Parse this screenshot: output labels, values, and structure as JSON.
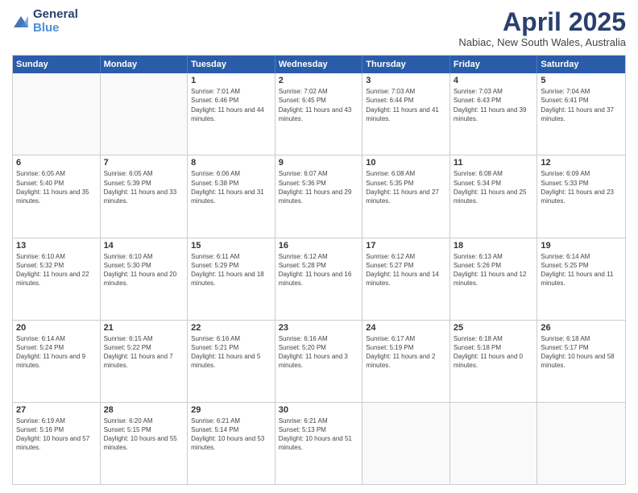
{
  "header": {
    "logo_line1": "General",
    "logo_line2": "Blue",
    "month": "April 2025",
    "location": "Nabiac, New South Wales, Australia"
  },
  "days_of_week": [
    "Sunday",
    "Monday",
    "Tuesday",
    "Wednesday",
    "Thursday",
    "Friday",
    "Saturday"
  ],
  "weeks": [
    [
      {
        "day": "",
        "sunrise": "",
        "sunset": "",
        "daylight": ""
      },
      {
        "day": "",
        "sunrise": "",
        "sunset": "",
        "daylight": ""
      },
      {
        "day": "1",
        "sunrise": "Sunrise: 7:01 AM",
        "sunset": "Sunset: 6:46 PM",
        "daylight": "Daylight: 11 hours and 44 minutes."
      },
      {
        "day": "2",
        "sunrise": "Sunrise: 7:02 AM",
        "sunset": "Sunset: 6:45 PM",
        "daylight": "Daylight: 11 hours and 43 minutes."
      },
      {
        "day": "3",
        "sunrise": "Sunrise: 7:03 AM",
        "sunset": "Sunset: 6:44 PM",
        "daylight": "Daylight: 11 hours and 41 minutes."
      },
      {
        "day": "4",
        "sunrise": "Sunrise: 7:03 AM",
        "sunset": "Sunset: 6:43 PM",
        "daylight": "Daylight: 11 hours and 39 minutes."
      },
      {
        "day": "5",
        "sunrise": "Sunrise: 7:04 AM",
        "sunset": "Sunset: 6:41 PM",
        "daylight": "Daylight: 11 hours and 37 minutes."
      }
    ],
    [
      {
        "day": "6",
        "sunrise": "Sunrise: 6:05 AM",
        "sunset": "Sunset: 5:40 PM",
        "daylight": "Daylight: 11 hours and 35 minutes."
      },
      {
        "day": "7",
        "sunrise": "Sunrise: 6:05 AM",
        "sunset": "Sunset: 5:39 PM",
        "daylight": "Daylight: 11 hours and 33 minutes."
      },
      {
        "day": "8",
        "sunrise": "Sunrise: 6:06 AM",
        "sunset": "Sunset: 5:38 PM",
        "daylight": "Daylight: 11 hours and 31 minutes."
      },
      {
        "day": "9",
        "sunrise": "Sunrise: 6:07 AM",
        "sunset": "Sunset: 5:36 PM",
        "daylight": "Daylight: 11 hours and 29 minutes."
      },
      {
        "day": "10",
        "sunrise": "Sunrise: 6:08 AM",
        "sunset": "Sunset: 5:35 PM",
        "daylight": "Daylight: 11 hours and 27 minutes."
      },
      {
        "day": "11",
        "sunrise": "Sunrise: 6:08 AM",
        "sunset": "Sunset: 5:34 PM",
        "daylight": "Daylight: 11 hours and 25 minutes."
      },
      {
        "day": "12",
        "sunrise": "Sunrise: 6:09 AM",
        "sunset": "Sunset: 5:33 PM",
        "daylight": "Daylight: 11 hours and 23 minutes."
      }
    ],
    [
      {
        "day": "13",
        "sunrise": "Sunrise: 6:10 AM",
        "sunset": "Sunset: 5:32 PM",
        "daylight": "Daylight: 11 hours and 22 minutes."
      },
      {
        "day": "14",
        "sunrise": "Sunrise: 6:10 AM",
        "sunset": "Sunset: 5:30 PM",
        "daylight": "Daylight: 11 hours and 20 minutes."
      },
      {
        "day": "15",
        "sunrise": "Sunrise: 6:11 AM",
        "sunset": "Sunset: 5:29 PM",
        "daylight": "Daylight: 11 hours and 18 minutes."
      },
      {
        "day": "16",
        "sunrise": "Sunrise: 6:12 AM",
        "sunset": "Sunset: 5:28 PM",
        "daylight": "Daylight: 11 hours and 16 minutes."
      },
      {
        "day": "17",
        "sunrise": "Sunrise: 6:12 AM",
        "sunset": "Sunset: 5:27 PM",
        "daylight": "Daylight: 11 hours and 14 minutes."
      },
      {
        "day": "18",
        "sunrise": "Sunrise: 6:13 AM",
        "sunset": "Sunset: 5:26 PM",
        "daylight": "Daylight: 11 hours and 12 minutes."
      },
      {
        "day": "19",
        "sunrise": "Sunrise: 6:14 AM",
        "sunset": "Sunset: 5:25 PM",
        "daylight": "Daylight: 11 hours and 11 minutes."
      }
    ],
    [
      {
        "day": "20",
        "sunrise": "Sunrise: 6:14 AM",
        "sunset": "Sunset: 5:24 PM",
        "daylight": "Daylight: 11 hours and 9 minutes."
      },
      {
        "day": "21",
        "sunrise": "Sunrise: 6:15 AM",
        "sunset": "Sunset: 5:22 PM",
        "daylight": "Daylight: 11 hours and 7 minutes."
      },
      {
        "day": "22",
        "sunrise": "Sunrise: 6:16 AM",
        "sunset": "Sunset: 5:21 PM",
        "daylight": "Daylight: 11 hours and 5 minutes."
      },
      {
        "day": "23",
        "sunrise": "Sunrise: 6:16 AM",
        "sunset": "Sunset: 5:20 PM",
        "daylight": "Daylight: 11 hours and 3 minutes."
      },
      {
        "day": "24",
        "sunrise": "Sunrise: 6:17 AM",
        "sunset": "Sunset: 5:19 PM",
        "daylight": "Daylight: 11 hours and 2 minutes."
      },
      {
        "day": "25",
        "sunrise": "Sunrise: 6:18 AM",
        "sunset": "Sunset: 5:18 PM",
        "daylight": "Daylight: 11 hours and 0 minutes."
      },
      {
        "day": "26",
        "sunrise": "Sunrise: 6:18 AM",
        "sunset": "Sunset: 5:17 PM",
        "daylight": "Daylight: 10 hours and 58 minutes."
      }
    ],
    [
      {
        "day": "27",
        "sunrise": "Sunrise: 6:19 AM",
        "sunset": "Sunset: 5:16 PM",
        "daylight": "Daylight: 10 hours and 57 minutes."
      },
      {
        "day": "28",
        "sunrise": "Sunrise: 6:20 AM",
        "sunset": "Sunset: 5:15 PM",
        "daylight": "Daylight: 10 hours and 55 minutes."
      },
      {
        "day": "29",
        "sunrise": "Sunrise: 6:21 AM",
        "sunset": "Sunset: 5:14 PM",
        "daylight": "Daylight: 10 hours and 53 minutes."
      },
      {
        "day": "30",
        "sunrise": "Sunrise: 6:21 AM",
        "sunset": "Sunset: 5:13 PM",
        "daylight": "Daylight: 10 hours and 51 minutes."
      },
      {
        "day": "",
        "sunrise": "",
        "sunset": "",
        "daylight": ""
      },
      {
        "day": "",
        "sunrise": "",
        "sunset": "",
        "daylight": ""
      },
      {
        "day": "",
        "sunrise": "",
        "sunset": "",
        "daylight": ""
      }
    ]
  ]
}
